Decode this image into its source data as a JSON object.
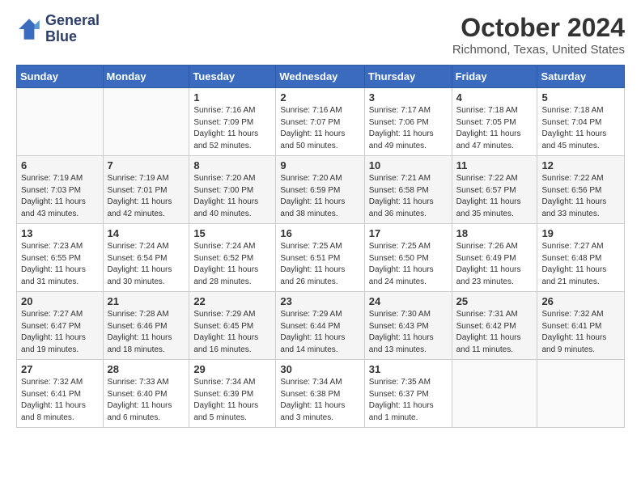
{
  "logo": {
    "line1": "General",
    "line2": "Blue"
  },
  "title": "October 2024",
  "location": "Richmond, Texas, United States",
  "days_of_week": [
    "Sunday",
    "Monday",
    "Tuesday",
    "Wednesday",
    "Thursday",
    "Friday",
    "Saturday"
  ],
  "weeks": [
    [
      {
        "day": "",
        "info": ""
      },
      {
        "day": "",
        "info": ""
      },
      {
        "day": "1",
        "info": "Sunrise: 7:16 AM\nSunset: 7:09 PM\nDaylight: 11 hours and 52 minutes."
      },
      {
        "day": "2",
        "info": "Sunrise: 7:16 AM\nSunset: 7:07 PM\nDaylight: 11 hours and 50 minutes."
      },
      {
        "day": "3",
        "info": "Sunrise: 7:17 AM\nSunset: 7:06 PM\nDaylight: 11 hours and 49 minutes."
      },
      {
        "day": "4",
        "info": "Sunrise: 7:18 AM\nSunset: 7:05 PM\nDaylight: 11 hours and 47 minutes."
      },
      {
        "day": "5",
        "info": "Sunrise: 7:18 AM\nSunset: 7:04 PM\nDaylight: 11 hours and 45 minutes."
      }
    ],
    [
      {
        "day": "6",
        "info": "Sunrise: 7:19 AM\nSunset: 7:03 PM\nDaylight: 11 hours and 43 minutes."
      },
      {
        "day": "7",
        "info": "Sunrise: 7:19 AM\nSunset: 7:01 PM\nDaylight: 11 hours and 42 minutes."
      },
      {
        "day": "8",
        "info": "Sunrise: 7:20 AM\nSunset: 7:00 PM\nDaylight: 11 hours and 40 minutes."
      },
      {
        "day": "9",
        "info": "Sunrise: 7:20 AM\nSunset: 6:59 PM\nDaylight: 11 hours and 38 minutes."
      },
      {
        "day": "10",
        "info": "Sunrise: 7:21 AM\nSunset: 6:58 PM\nDaylight: 11 hours and 36 minutes."
      },
      {
        "day": "11",
        "info": "Sunrise: 7:22 AM\nSunset: 6:57 PM\nDaylight: 11 hours and 35 minutes."
      },
      {
        "day": "12",
        "info": "Sunrise: 7:22 AM\nSunset: 6:56 PM\nDaylight: 11 hours and 33 minutes."
      }
    ],
    [
      {
        "day": "13",
        "info": "Sunrise: 7:23 AM\nSunset: 6:55 PM\nDaylight: 11 hours and 31 minutes."
      },
      {
        "day": "14",
        "info": "Sunrise: 7:24 AM\nSunset: 6:54 PM\nDaylight: 11 hours and 30 minutes."
      },
      {
        "day": "15",
        "info": "Sunrise: 7:24 AM\nSunset: 6:52 PM\nDaylight: 11 hours and 28 minutes."
      },
      {
        "day": "16",
        "info": "Sunrise: 7:25 AM\nSunset: 6:51 PM\nDaylight: 11 hours and 26 minutes."
      },
      {
        "day": "17",
        "info": "Sunrise: 7:25 AM\nSunset: 6:50 PM\nDaylight: 11 hours and 24 minutes."
      },
      {
        "day": "18",
        "info": "Sunrise: 7:26 AM\nSunset: 6:49 PM\nDaylight: 11 hours and 23 minutes."
      },
      {
        "day": "19",
        "info": "Sunrise: 7:27 AM\nSunset: 6:48 PM\nDaylight: 11 hours and 21 minutes."
      }
    ],
    [
      {
        "day": "20",
        "info": "Sunrise: 7:27 AM\nSunset: 6:47 PM\nDaylight: 11 hours and 19 minutes."
      },
      {
        "day": "21",
        "info": "Sunrise: 7:28 AM\nSunset: 6:46 PM\nDaylight: 11 hours and 18 minutes."
      },
      {
        "day": "22",
        "info": "Sunrise: 7:29 AM\nSunset: 6:45 PM\nDaylight: 11 hours and 16 minutes."
      },
      {
        "day": "23",
        "info": "Sunrise: 7:29 AM\nSunset: 6:44 PM\nDaylight: 11 hours and 14 minutes."
      },
      {
        "day": "24",
        "info": "Sunrise: 7:30 AM\nSunset: 6:43 PM\nDaylight: 11 hours and 13 minutes."
      },
      {
        "day": "25",
        "info": "Sunrise: 7:31 AM\nSunset: 6:42 PM\nDaylight: 11 hours and 11 minutes."
      },
      {
        "day": "26",
        "info": "Sunrise: 7:32 AM\nSunset: 6:41 PM\nDaylight: 11 hours and 9 minutes."
      }
    ],
    [
      {
        "day": "27",
        "info": "Sunrise: 7:32 AM\nSunset: 6:41 PM\nDaylight: 11 hours and 8 minutes."
      },
      {
        "day": "28",
        "info": "Sunrise: 7:33 AM\nSunset: 6:40 PM\nDaylight: 11 hours and 6 minutes."
      },
      {
        "day": "29",
        "info": "Sunrise: 7:34 AM\nSunset: 6:39 PM\nDaylight: 11 hours and 5 minutes."
      },
      {
        "day": "30",
        "info": "Sunrise: 7:34 AM\nSunset: 6:38 PM\nDaylight: 11 hours and 3 minutes."
      },
      {
        "day": "31",
        "info": "Sunrise: 7:35 AM\nSunset: 6:37 PM\nDaylight: 11 hours and 1 minute."
      },
      {
        "day": "",
        "info": ""
      },
      {
        "day": "",
        "info": ""
      }
    ]
  ]
}
